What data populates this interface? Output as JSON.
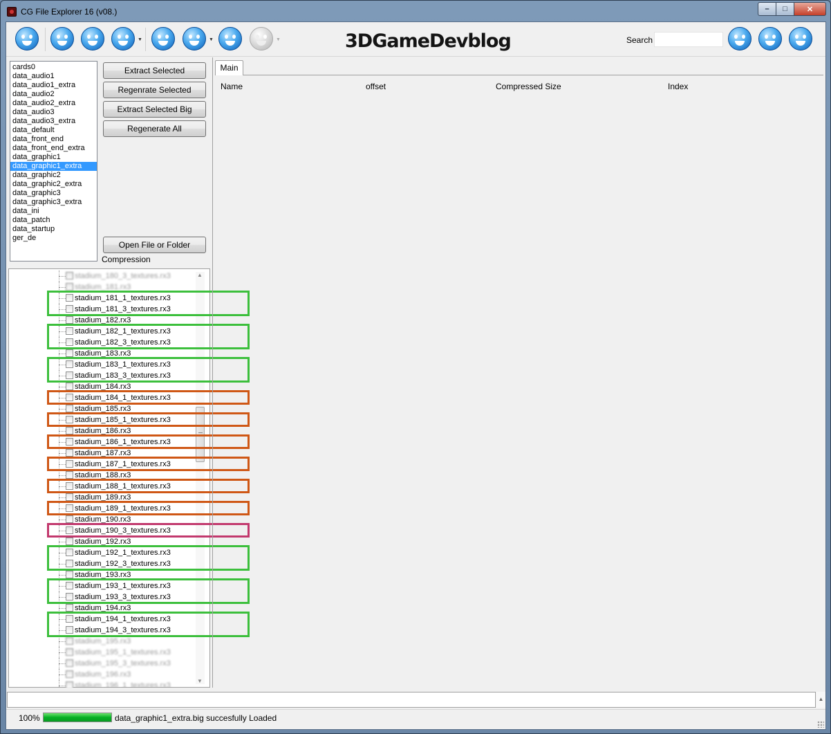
{
  "window": {
    "title": "CG File Explorer 16 (v08.)",
    "minimize_label": "–",
    "maximize_label": "□",
    "close_label": "✕"
  },
  "toolbar": {
    "logo_text": "3DGameDevblog",
    "search_label": "Search",
    "search_value": "",
    "icons": [
      "smiley-grin-icon",
      "smiley-shout-icon",
      "smiley-surprised-icon",
      "smiley-sad-icon",
      "smiley-laugh-icon",
      "smiley-wink-icon",
      "smiley-happy-icon",
      "smiley-disabled-icon",
      "smiley-confused-icon",
      "smiley-tongue-icon",
      "smiley-big-grin-icon"
    ]
  },
  "file_list": {
    "items": [
      "cards0",
      "data_audio1",
      "data_audio1_extra",
      "data_audio2",
      "data_audio2_extra",
      "data_audio3",
      "data_audio3_extra",
      "data_default",
      "data_front_end",
      "data_front_end_extra",
      "data_graphic1",
      "data_graphic1_extra",
      "data_graphic2",
      "data_graphic2_extra",
      "data_graphic3",
      "data_graphic3_extra",
      "data_ini",
      "data_patch",
      "data_startup",
      "ger_de"
    ],
    "selected": "data_graphic1_extra"
  },
  "buttons": {
    "extract_selected": "Extract Selected",
    "regenerate_selected": "Regenrate Selected",
    "extract_selected_big": "Extract Selected Big",
    "regenerate_all": "Regenerate All",
    "open_file_or_folder": "Open File or Folder"
  },
  "compression_label": "Compression",
  "tree": {
    "rows": [
      {
        "label": "stadium_180_3_textures.rx3",
        "blurred": true
      },
      {
        "label": "stadium_181.rx3",
        "blurred": true
      },
      {
        "label": "stadium_181_1_textures.rx3",
        "blurred": false
      },
      {
        "label": "stadium_181_3_textures.rx3",
        "blurred": false
      },
      {
        "label": "stadium_182.rx3",
        "blurred": false
      },
      {
        "label": "stadium_182_1_textures.rx3",
        "blurred": false
      },
      {
        "label": "stadium_182_3_textures.rx3",
        "blurred": false
      },
      {
        "label": "stadium_183.rx3",
        "blurred": false
      },
      {
        "label": "stadium_183_1_textures.rx3",
        "blurred": false
      },
      {
        "label": "stadium_183_3_textures.rx3",
        "blurred": false
      },
      {
        "label": "stadium_184.rx3",
        "blurred": false
      },
      {
        "label": "stadium_184_1_textures.rx3",
        "blurred": false
      },
      {
        "label": "stadium_185.rx3",
        "blurred": false
      },
      {
        "label": "stadium_185_1_textures.rx3",
        "blurred": false
      },
      {
        "label": "stadium_186.rx3",
        "blurred": false
      },
      {
        "label": "stadium_186_1_textures.rx3",
        "blurred": false
      },
      {
        "label": "stadium_187.rx3",
        "blurred": false
      },
      {
        "label": "stadium_187_1_textures.rx3",
        "blurred": false
      },
      {
        "label": "stadium_188.rx3",
        "blurred": false
      },
      {
        "label": "stadium_188_1_textures.rx3",
        "blurred": false
      },
      {
        "label": "stadium_189.rx3",
        "blurred": false
      },
      {
        "label": "stadium_189_1_textures.rx3",
        "blurred": false
      },
      {
        "label": "stadium_190.rx3",
        "blurred": false
      },
      {
        "label": "stadium_190_3_textures.rx3",
        "blurred": false
      },
      {
        "label": "stadium_192.rx3",
        "blurred": false
      },
      {
        "label": "stadium_192_1_textures.rx3",
        "blurred": false
      },
      {
        "label": "stadium_192_3_textures.rx3",
        "blurred": false
      },
      {
        "label": "stadium_193.rx3",
        "blurred": false
      },
      {
        "label": "stadium_193_1_textures.rx3",
        "blurred": false
      },
      {
        "label": "stadium_193_3_textures.rx3",
        "blurred": false
      },
      {
        "label": "stadium_194.rx3",
        "blurred": false
      },
      {
        "label": "stadium_194_1_textures.rx3",
        "blurred": false
      },
      {
        "label": "stadium_194_3_textures.rx3",
        "blurred": false
      },
      {
        "label": "stadium_195.rx3",
        "blurred": true
      },
      {
        "label": "stadium_195_1_textures.rx3",
        "blurred": true
      },
      {
        "label": "stadium_195_3_textures.rx3",
        "blurred": true
      },
      {
        "label": "stadium_196.rx3",
        "blurred": true
      },
      {
        "label": "stadium_196_1_textures.rx3",
        "blurred": true
      }
    ]
  },
  "highlight_colors": {
    "green": "#3cbf3c",
    "orange": "#cf5715",
    "pink": "#c2386d"
  },
  "main_tab": {
    "label": "Main",
    "columns": [
      "Name",
      "offset",
      "Compressed Size",
      "Index"
    ]
  },
  "status": {
    "percent": "100%",
    "progress": 1.0,
    "message": "data_graphic1_extra.big succesfully Loaded"
  }
}
